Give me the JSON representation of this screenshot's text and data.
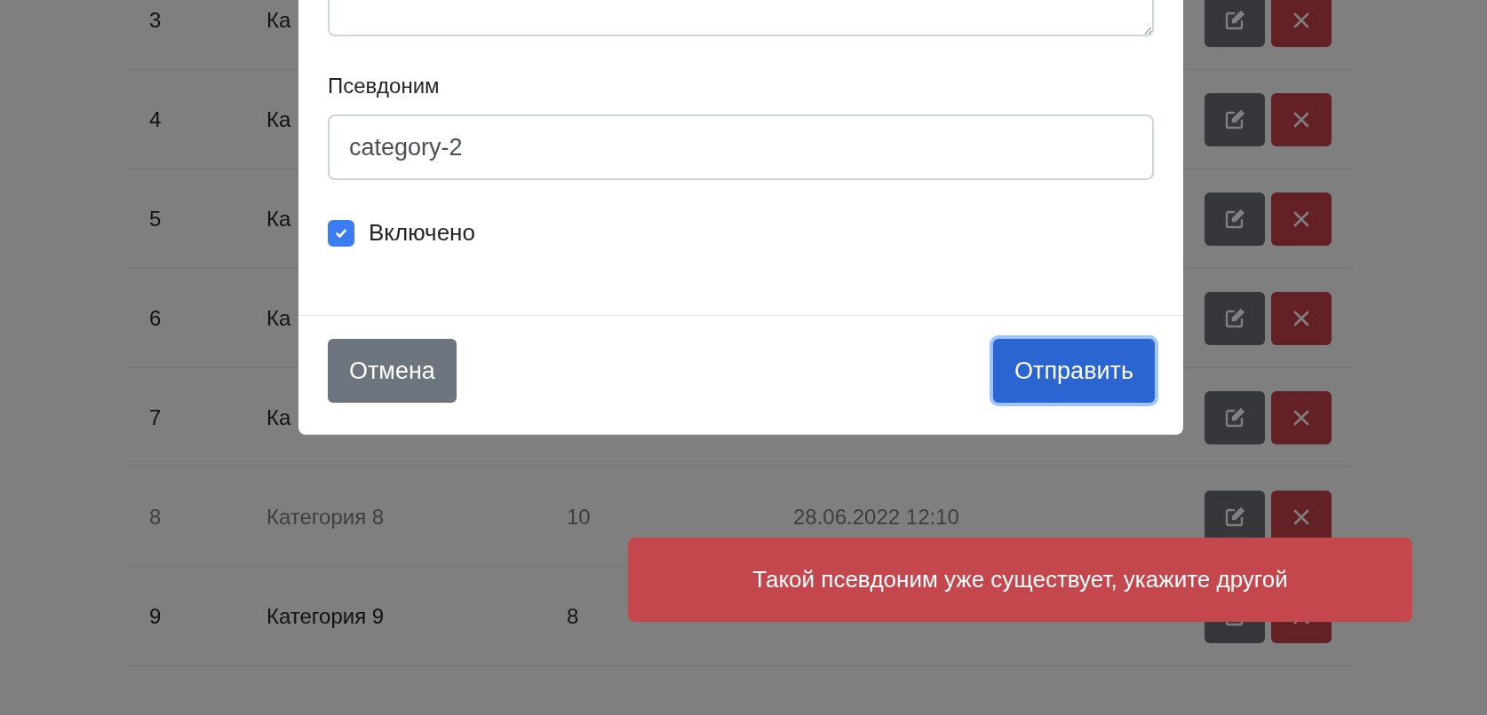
{
  "table": {
    "rows": [
      {
        "number": "3",
        "name": "Ка",
        "enabled": true
      },
      {
        "number": "4",
        "name": "Ка",
        "enabled": true
      },
      {
        "number": "5",
        "name": "Ка",
        "enabled": true
      },
      {
        "number": "6",
        "name": "Ка",
        "enabled": true
      },
      {
        "number": "7",
        "name": "Ка",
        "enabled": true
      },
      {
        "number": "8",
        "name": "Категория 8",
        "count": "10",
        "date": "28.06.2022 12:10",
        "enabled": false
      },
      {
        "number": "9",
        "name": "Категория 9",
        "count": "8",
        "enabled": true
      }
    ]
  },
  "modal": {
    "fields": [
      {
        "kind": "textarea"
      },
      {
        "kind": "text",
        "label": "Псевдоним",
        "value": "category-2"
      },
      {
        "kind": "checkbox",
        "label": "Включено",
        "checked": true
      }
    ],
    "buttons": [
      {
        "label": "Отмена",
        "kind": "secondary",
        "focused": false
      },
      {
        "label": "Отправить",
        "kind": "primary",
        "focused": true
      }
    ]
  },
  "toast": {
    "message": "Такой псевдоним уже существует, укажите другой",
    "kind": "danger"
  }
}
